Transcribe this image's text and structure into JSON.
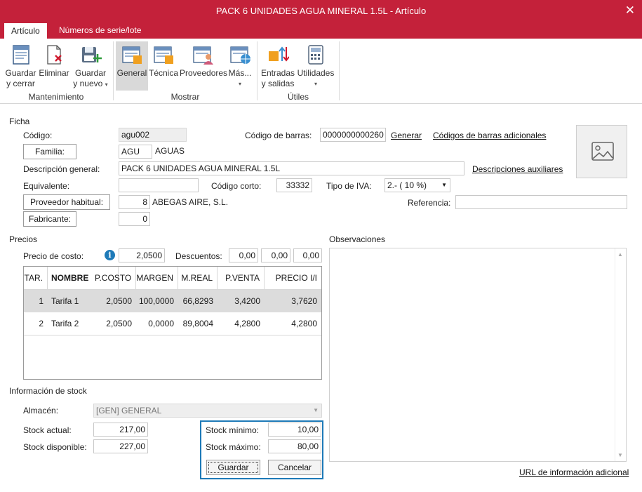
{
  "window": {
    "title": "PACK 6 UNIDADES AGUA MINERAL 1.5L - Artículo",
    "close_glyph": "✕"
  },
  "tabs": [
    {
      "label": "Artículo",
      "active": true
    },
    {
      "label": "Números de serie/lote",
      "active": false
    }
  ],
  "ribbon": {
    "groups": [
      {
        "label": "Mantenimiento",
        "buttons": [
          {
            "label1": "Guardar",
            "label2": "y cerrar",
            "icon": "save-close-icon"
          },
          {
            "label1": "Eliminar",
            "label2": "",
            "icon": "delete-icon"
          },
          {
            "label1": "Guardar",
            "label2": "y nuevo",
            "icon": "save-new-icon",
            "caret": "▾"
          }
        ]
      },
      {
        "label": "Mostrar",
        "buttons": [
          {
            "label1": "General",
            "icon": "general-icon",
            "selected": true
          },
          {
            "label1": "Técnica",
            "icon": "technical-icon"
          },
          {
            "label1": "Proveedores",
            "icon": "suppliers-icon"
          },
          {
            "label1": "Más...",
            "icon": "more-icon",
            "caret": "▾"
          }
        ]
      },
      {
        "label": "Útiles",
        "buttons": [
          {
            "label1": "Entradas",
            "label2": "y salidas",
            "icon": "in-out-icon"
          },
          {
            "label1": "Utilidades",
            "icon": "calculator-icon",
            "caret": "▾"
          }
        ]
      }
    ]
  },
  "ficha": {
    "section": "Ficha",
    "codigo_label": "Código:",
    "codigo": "agu002",
    "familia_btn": "Familia:",
    "familia_code": "AGU",
    "familia_name": "AGUAS",
    "descripcion_label": "Descripción general:",
    "descripcion": "PACK 6 UNIDADES AGUA MINERAL 1.5L",
    "equivalente_label": "Equivalente:",
    "equivalente": "",
    "proveedor_btn": "Proveedor habitual:",
    "proveedor_code": "8",
    "proveedor_name": "ABEGAS AIRE, S.L.",
    "fabricante_btn": "Fabricante:",
    "fabricante": "0",
    "barras_label": "Código de barras:",
    "barras": "0000000000260",
    "generar_link": "Generar",
    "barras_adic_link": "Códigos de barras adicionales",
    "desc_aux_link": "Descripciones auxiliares",
    "corto_label": "Código corto:",
    "corto": "33332",
    "iva_label": "Tipo de IVA:",
    "iva": "2.- ( 10 %)",
    "referencia_label": "Referencia:",
    "referencia": ""
  },
  "precios": {
    "section": "Precios",
    "costo_label": "Precio de costo:",
    "costo": "2,0500",
    "descuentos_label": "Descuentos:",
    "dto1": "0,00",
    "dto2": "0,00",
    "dto3": "0,00",
    "columns": [
      "TAR.",
      "NOMBRE",
      "P.COSTO",
      "MARGEN",
      "M.REAL",
      "P.VENTA",
      "PRECIO I/I"
    ],
    "rows": [
      [
        "1",
        "Tarifa 1",
        "2,0500",
        "100,0000",
        "66,8293",
        "3,4200",
        "3,7620"
      ],
      [
        "2",
        "Tarifa 2",
        "2,0500",
        "0,0000",
        "89,8004",
        "4,2800",
        "4,2800"
      ]
    ]
  },
  "stock": {
    "section": "Información de stock",
    "almacen_label": "Almacén:",
    "almacen": "[GEN] GENERAL",
    "actual_label": "Stock actual:",
    "actual": "217,00",
    "disponible_label": "Stock disponible:",
    "disponible": "227,00",
    "minimo_label": "Stock mínimo:",
    "minimo": "10,00",
    "maximo_label": "Stock máximo:",
    "maximo": "80,00",
    "guardar_btn": "Guardar",
    "cancelar_btn": "Cancelar"
  },
  "observaciones": {
    "label": "Observaciones",
    "url_link": "URL de información adicional"
  },
  "colors": {
    "titlebar": "#c4213a",
    "focus_border": "#1e7ab8"
  }
}
